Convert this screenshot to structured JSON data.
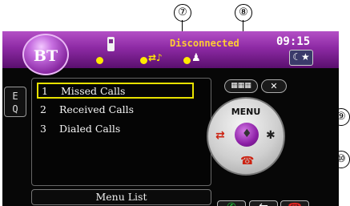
{
  "header": {
    "bt_label": "BT",
    "status": "Disconnected",
    "time": "09:15"
  },
  "side": {
    "eq_label": "E\nQ"
  },
  "menu": {
    "items": [
      {
        "num": "1",
        "label": "Missed Calls",
        "selected": true
      },
      {
        "num": "2",
        "label": "Received Calls",
        "selected": false
      },
      {
        "num": "3",
        "label": "Dialed Calls",
        "selected": false
      }
    ],
    "footer": "Menu List"
  },
  "controls": {
    "pad_menu": "MENU",
    "keypad_icon": "keypad-icon",
    "settings_icon": "wrench-icon"
  },
  "callouts": [
    "⑦",
    "⑧",
    "⑨",
    "⑩"
  ],
  "colors": {
    "accent_purple": "#8d2aa4",
    "status_yellow": "#ffcc33",
    "selection_yellow": "#e7e100"
  }
}
